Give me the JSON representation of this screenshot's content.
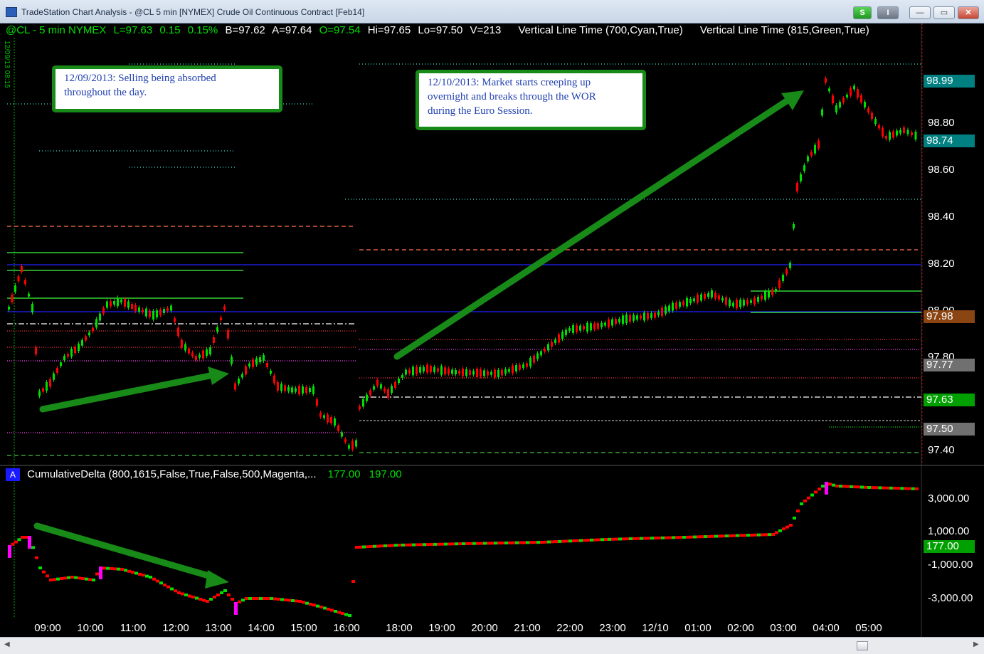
{
  "window": {
    "title": "TradeStation Chart Analysis - @CL 5 min [NYMEX] Crude Oil Continuous Contract [Feb14]",
    "btn_s": "S",
    "btn_i": "I",
    "btn_min": "—",
    "btn_max": "▭",
    "btn_close": "✕"
  },
  "header": {
    "symbol": "@CL - 5 min  NYMEX",
    "last": "L=97.63",
    "change": "0.15",
    "change_pct": "0.15%",
    "bid": "B=97.62",
    "ask": "A=97.64",
    "open": "O=97.54",
    "high": "Hi=97.65",
    "low": "Lo=97.50",
    "volume": "V=213",
    "study1": "Vertical Line Time (700,Cyan,True)",
    "study2": "Vertical Line Time (815,Green,True)",
    "date_marker": "12/09/13 08:15"
  },
  "annotations": {
    "note1": "12/09/2013: Selling being absorbed\nthroughout the day.",
    "note2": "12/10/2013: Market starts creeping up\novernight and breaks through the WOR\nduring the Euro Session."
  },
  "price_axis": {
    "ticks": [
      "98.80",
      "98.60",
      "98.40",
      "98.20",
      "98.00",
      "97.80",
      "97.40"
    ],
    "labels": [
      {
        "text": "98.99",
        "color": "#008080"
      },
      {
        "text": "98.74",
        "color": "#008080"
      },
      {
        "text": "97.98",
        "color": "#8b4513"
      },
      {
        "text": "97.77",
        "color": "#707070"
      },
      {
        "text": "97.63",
        "color": "#00a000"
      },
      {
        "text": "97.50",
        "color": "#707070"
      }
    ]
  },
  "indicator": {
    "icon": "A",
    "name": "CumulativeDelta (800,1615,False,True,False,500,Magenta,...",
    "value1": "177.00",
    "value2": "197.00",
    "ticks": [
      "3,000.00",
      "1,000.00",
      "-1,000.00",
      "-3,000.00"
    ],
    "current": "177.00"
  },
  "time_axis": [
    "09:00",
    "10:00",
    "11:00",
    "12:00",
    "13:00",
    "14:00",
    "15:00",
    "16:00",
    "18:00",
    "19:00",
    "20:00",
    "21:00",
    "22:00",
    "23:00",
    "12/10",
    "01:00",
    "02:00",
    "03:00",
    "04:00",
    "05:00"
  ],
  "colors": {
    "up_bar": "#00e000",
    "down_bar": "#ff0000",
    "arrow": "#188a18",
    "cyan": "#40e0d0",
    "delta_extreme": "#ff00ff"
  }
}
